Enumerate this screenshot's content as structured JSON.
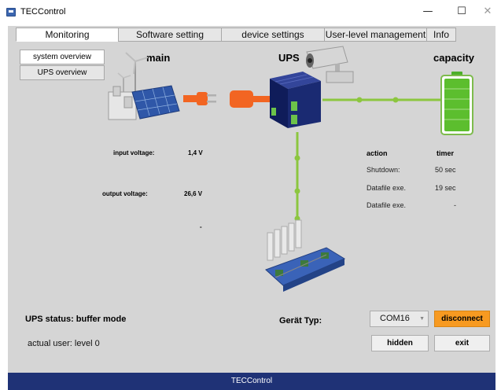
{
  "window": {
    "title": "TECControl",
    "minimize_glyph": "—",
    "maximize_glyph": "☐",
    "close_glyph": "✕"
  },
  "tabs": [
    {
      "label": "Monitoring",
      "active": true
    },
    {
      "label": "Software setting",
      "active": false
    },
    {
      "label": "device settings",
      "active": false
    },
    {
      "label": "User-level management",
      "active": false
    },
    {
      "label": "Info",
      "active": false
    }
  ],
  "side_nav": [
    {
      "label": "system overview",
      "active": true
    },
    {
      "label": "UPS overview",
      "active": false
    }
  ],
  "sections": {
    "main": "main",
    "ups": "UPS",
    "capacity": "capacity"
  },
  "readings": {
    "input_voltage_label": "input voltage:",
    "input_voltage_value": "1,4 V",
    "output_voltage_label": "output voltage:",
    "output_voltage_value": "26,6 V",
    "extra_value": "-"
  },
  "actions_table": {
    "action_header": "action",
    "timer_header": "timer",
    "rows": [
      {
        "action": "Shutdown:",
        "timer": "50 sec"
      },
      {
        "action": "Datafile exe.",
        "timer": "19 sec"
      },
      {
        "action": "Datafile exe.",
        "timer": "-"
      }
    ]
  },
  "status": {
    "ups_status": "UPS status: buffer mode",
    "actual_user": "actual user: level 0"
  },
  "device": {
    "geraet_typ_label": "Gerät Typ:",
    "port_value": "COM16"
  },
  "buttons": {
    "disconnect": "disconnect",
    "hidden": "hidden",
    "exit": "exit"
  },
  "footer": {
    "text": "TECControl"
  },
  "colors": {
    "accent_orange": "#f79a21",
    "footer_navy": "#1f3276",
    "flow_green": "#8cc63f",
    "battery_green": "#5cbe2e"
  },
  "battery": {
    "level_fraction": 1.0
  }
}
